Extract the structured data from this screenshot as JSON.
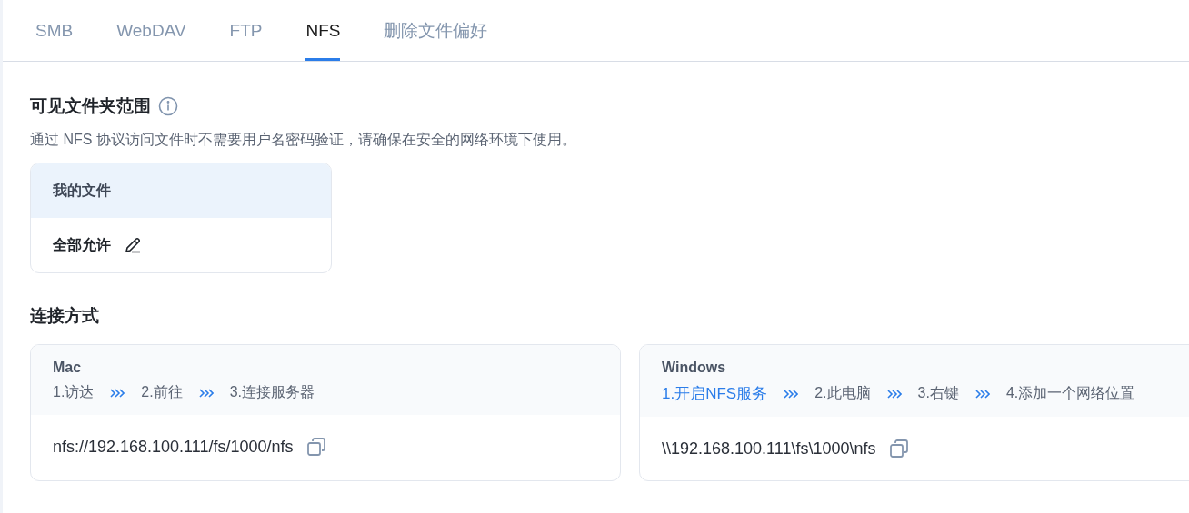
{
  "tabs": [
    {
      "label": "SMB",
      "selected": false
    },
    {
      "label": "WebDAV",
      "selected": false
    },
    {
      "label": "FTP",
      "selected": false
    },
    {
      "label": "NFS",
      "selected": true
    },
    {
      "label": "删除文件偏好",
      "selected": false
    }
  ],
  "visible_scope": {
    "title": "可见文件夹范围",
    "description": "通过 NFS 协议访问文件时不需要用户名密码验证，请确保在安全的网络环境下使用。",
    "folder": "我的文件",
    "permission": "全部允许"
  },
  "connection": {
    "title": "连接方式",
    "methods": [
      {
        "name": "Mac",
        "steps": [
          {
            "text": "1.访达",
            "kind": "text"
          },
          {
            "text": "2.前往",
            "kind": "text"
          },
          {
            "text": "3.连接服务器",
            "kind": "text"
          }
        ],
        "address": "nfs://192.168.100.111/fs/1000/nfs"
      },
      {
        "name": "Windows",
        "steps": [
          {
            "text": "1.开启NFS服务",
            "kind": "link"
          },
          {
            "text": "2.此电脑",
            "kind": "text"
          },
          {
            "text": "3.右键",
            "kind": "text"
          },
          {
            "text": "4.添加一个网络位置",
            "kind": "text"
          }
        ],
        "address": "\\\\192.168.100.111\\fs\\1000\\nfs"
      }
    ]
  }
}
